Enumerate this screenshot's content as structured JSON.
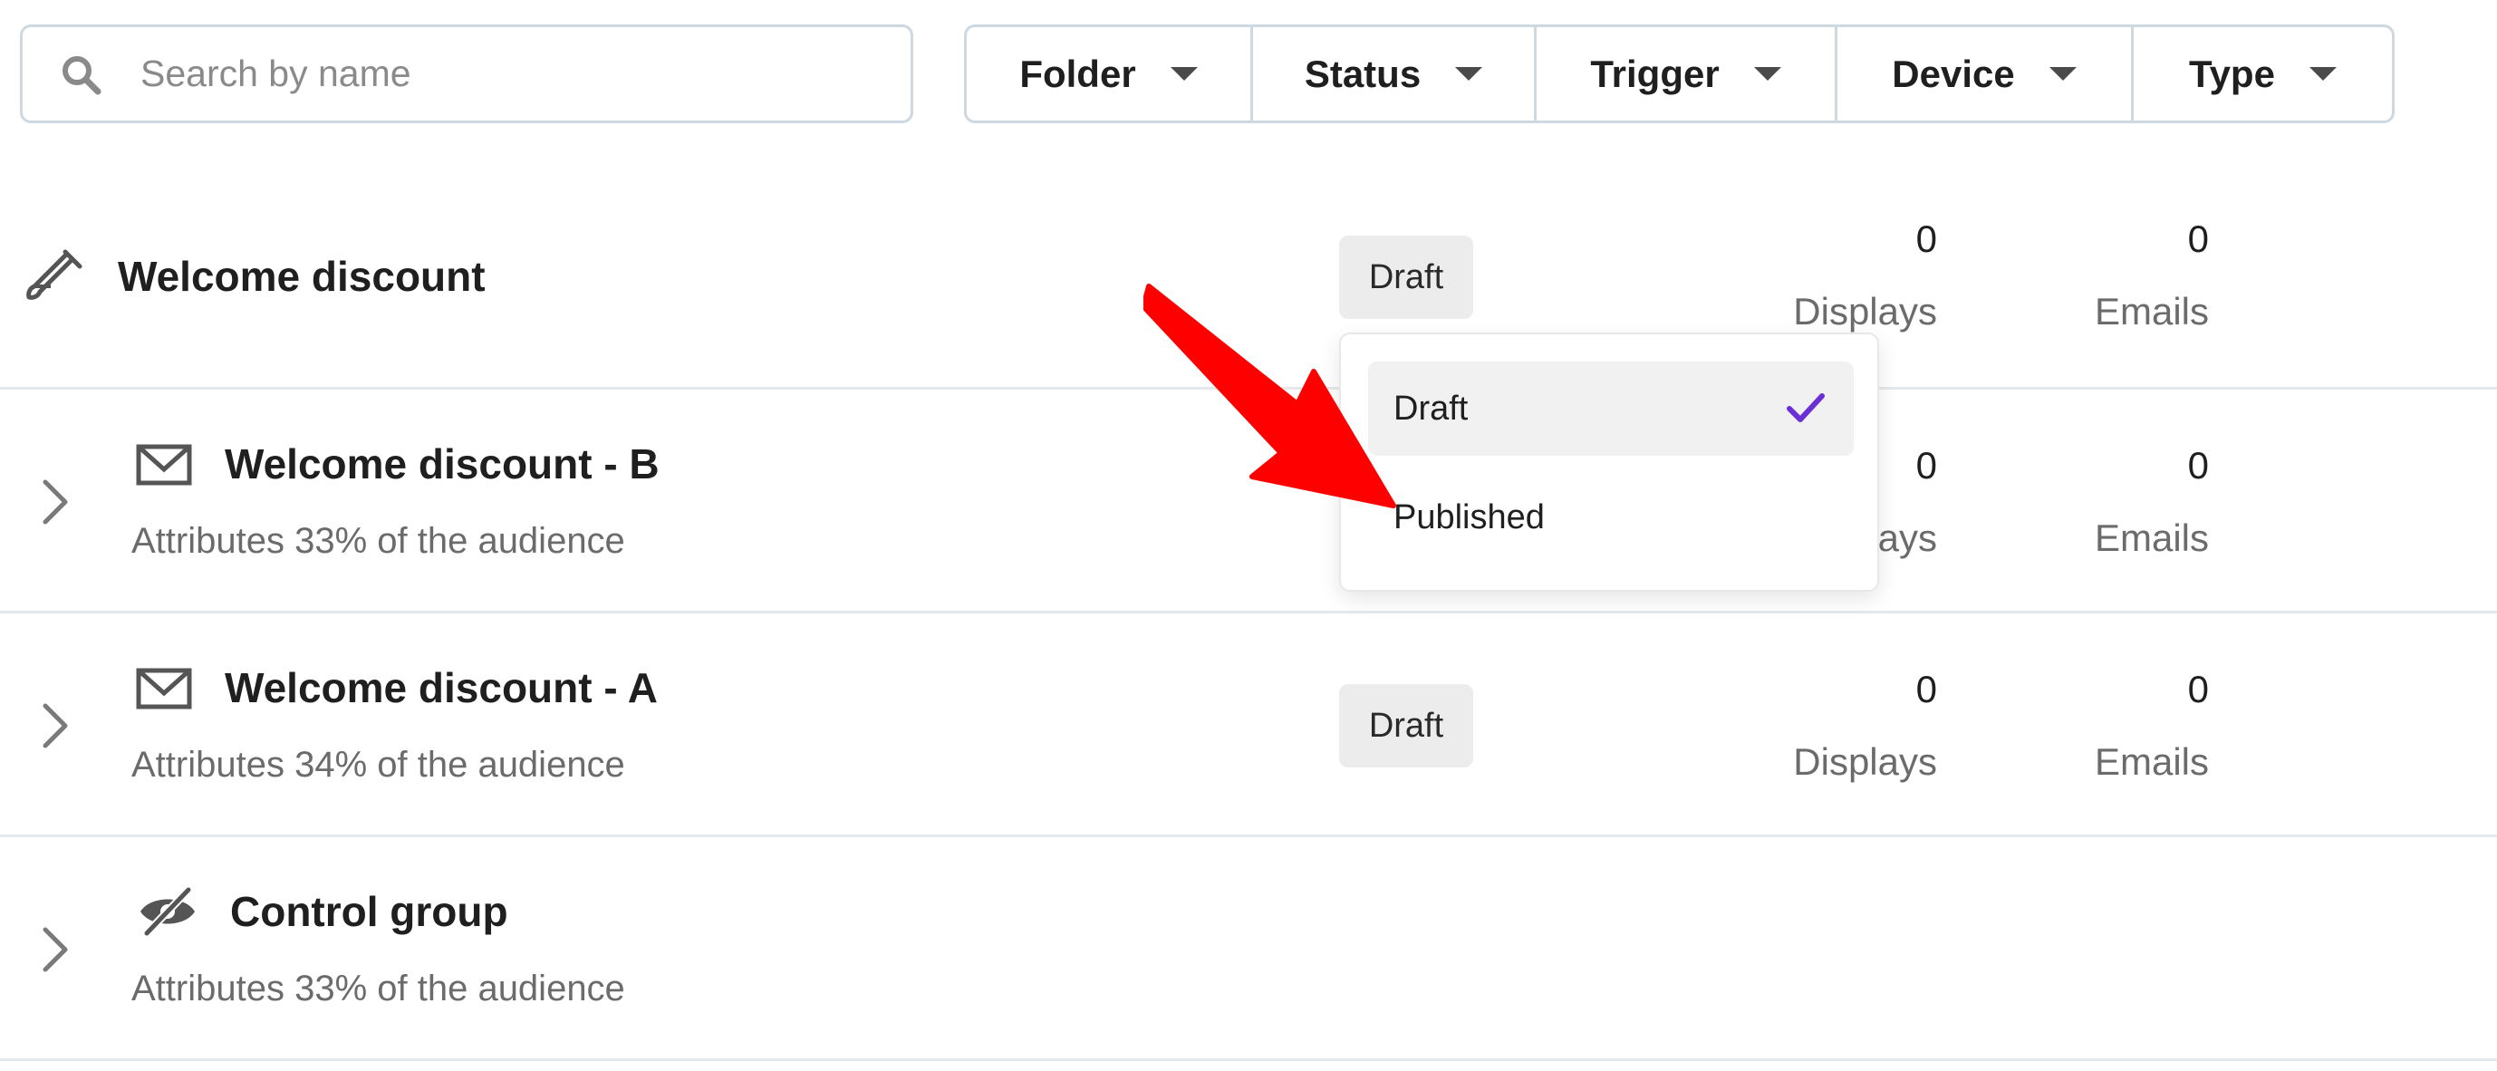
{
  "search": {
    "placeholder": "Search by name",
    "icon": "search-icon"
  },
  "filters": [
    {
      "label": "Folder"
    },
    {
      "label": "Status"
    },
    {
      "label": "Trigger"
    },
    {
      "label": "Device"
    },
    {
      "label": "Type"
    }
  ],
  "parent": {
    "title": "Welcome discount",
    "icon": "test-tube-icon",
    "status": "Draft",
    "displays_value": "0",
    "displays_label": "Displays",
    "emails_value": "0",
    "emails_label": "Emails"
  },
  "variants": [
    {
      "title": "Welcome discount - B",
      "icon": "envelope-icon",
      "subtitle": "Attributes 33% of the audience",
      "displays_value": "0",
      "displays_label": "Displays",
      "emails_value": "0",
      "emails_label": "Emails"
    },
    {
      "title": "Welcome discount - A",
      "icon": "envelope-icon",
      "subtitle": "Attributes 34% of the audience",
      "status": "Draft",
      "displays_value": "0",
      "displays_label": "Displays",
      "emails_value": "0",
      "emails_label": "Emails"
    },
    {
      "title": "Control group",
      "icon": "eye-slash-icon",
      "subtitle": "Attributes 33% of the audience"
    }
  ],
  "status_dropdown": {
    "options": [
      {
        "label": "Draft",
        "selected": true
      },
      {
        "label": "Published",
        "selected": false
      }
    ]
  },
  "colors": {
    "border": "#cdd8e1",
    "check": "#6b2fd6",
    "annotation_arrow": "#ff0000"
  }
}
